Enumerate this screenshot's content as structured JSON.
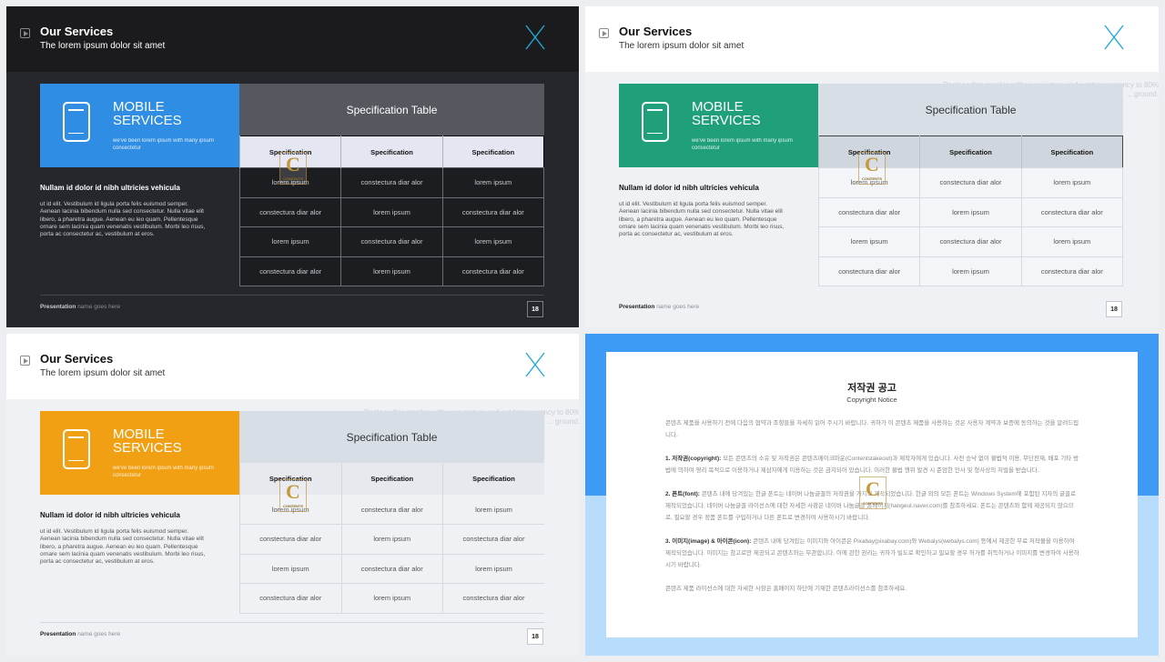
{
  "header": {
    "title": "Our Services",
    "subtitle": "The lorem ipsum dolor sit amet"
  },
  "ghost_text": "Replace this graphic with your picture and set transparency to 80% ... ground.",
  "feature": {
    "title_line1": "MOBILE",
    "title_line2": "SERVICES",
    "subtitle": "we've been lorem ipsum with many ipsum consectetur"
  },
  "lead": {
    "title": "Nullam id dolor id nibh ultricies vehicula",
    "body": "ut id elit. Vestibulum id ligula porta felis euismod semper. Aenean lacinia bibendum nulla sed consectetur. Nulla vitae elit libero, a pharetra augue. Aenean eu leo quam. Pellentesque ornare sem lacinia quam venenatis vestibulum. Morbi leo risus, porta ac consectetur ac, vestibulum at eros."
  },
  "spec_table": {
    "title": "Specification Table",
    "headers": [
      "Specification",
      "Specification",
      "Specification"
    ],
    "rows": [
      [
        "lorem ipsum",
        "constectura diar alor",
        "lorem ipsum"
      ],
      [
        "constectura diar alor",
        "lorem ipsum",
        "constectura diar alor"
      ],
      [
        "lorem ipsum",
        "constectura diar alor",
        "lorem ipsum"
      ],
      [
        "constectura diar alor",
        "lorem ipsum",
        "constectura diar alor"
      ]
    ]
  },
  "footer": {
    "brand": "Presentation",
    "note": "name goes here",
    "page": "18"
  },
  "watermark": {
    "letter": "C",
    "text": "CONTENTS"
  },
  "colors": {
    "slide1_accent": "#2f8de4",
    "slide2_accent": "#20a07a",
    "slide3_accent": "#f2a013",
    "notice_blue": "#3d9af5",
    "x_logo_cyan": "#22a9d8"
  },
  "notice": {
    "title": "저작권 공고",
    "subtitle": "Copyright Notice",
    "intro": "콘텐츠 제품을 사용하기 전에 다음의 협약과 조항들을 자세히 읽어 주시기 바랍니다. 귀하가 이 콘텐츠 제품을 사용하는 것은 사용자 계약과 보증에 동의하는 것을 알려드립니다.",
    "p1_label": "1. 저작권(copyright):",
    "p1_text": "모든 콘텐츠의 소유 및 저작권은 콘텐츠메이크마운(Contentstakeout)과 제작자에게 있습니다. 사전 승낙 없이 불법적 이용, 무단전재, 배포 기타 방법에 의하여 영리 목적으로 이용하거나 제삼자에게 이용하는 것은 금지되어 있습니다. 이러한 불법 행위 발견 시 준엄한 인사 및 형사상의 처벌을 받습니다.",
    "p2_label": "2. 폰트(font):",
    "p2_text": "콘텐츠 내에 당겨있는 한글 폰트는 네이버 나눔글꼴의 저작권을 가지고 제작되었습니다. 한글 외의 모든 폰트는 Windows System에 포함된 지자의 글꼴로 제작되었습니다. 네이버 나눔글꼴 라이선스에 대한 자세한 사항은 네이버 나눔글꼴 홈페이지(hangeul.naver.com)를 참조하세요. 폰트는 콘텐츠와 함께 제공되지 않으므로, 필요할 경우 정품 폰트를 구입하거나 다른 폰트로 변경하여 사용하시기 바랍니다.",
    "p3_label": "3. 이미지(image) & 아이콘(icon):",
    "p3_text": "콘텐츠 내에 당겨있는 이미지와 아이콘은 Pixabay(pixabay.com)와 Webalys(webalys.com) 등에서 제공한 무료 저작물을 이용하여 제작되었습니다. 이미지는 참고로만 제공되고 콘텐츠와는 무관합니다. 이에 관한 권리는 귀하가 빌도로 확인하고 필요할 경우 허가를 취득하거나 이미지를 변경하여 사용하시기 바랍니다.",
    "closing": "콘텐츠 제품 라이선스에 대한 자세한 사항은 홈페이지 하단에 기재한 콘텐츠라이선스를 참조하세요."
  }
}
